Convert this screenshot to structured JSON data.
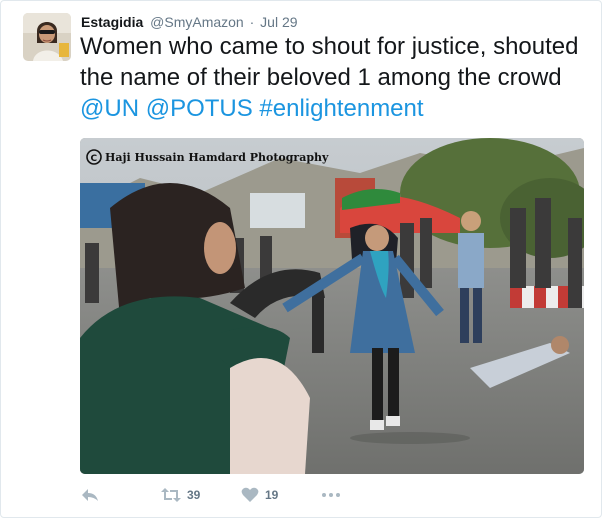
{
  "tweet": {
    "display_name": "Estagidia",
    "handle": "@SmyAmazon",
    "separator": "·",
    "timestamp": "Jul 29",
    "text_before_links": "Women who came to shout for justice, shouted the name of their beloved 1 among the crowd ",
    "mention_un": "@UN",
    "mention_potus": "@POTUS",
    "hashtag": "#enlightenment"
  },
  "photo": {
    "watermark": "Haji Hussain Hamdard Photography"
  },
  "actions": {
    "reply_icon": "reply-icon",
    "retweet_icon": "retweet-icon",
    "retweet_count": "39",
    "like_icon": "heart-icon",
    "like_count": "19",
    "more_icon": "more-icon"
  },
  "colors": {
    "link": "#1b95e0",
    "secondary_text": "#657786",
    "action_icon": "#aab8c2"
  }
}
